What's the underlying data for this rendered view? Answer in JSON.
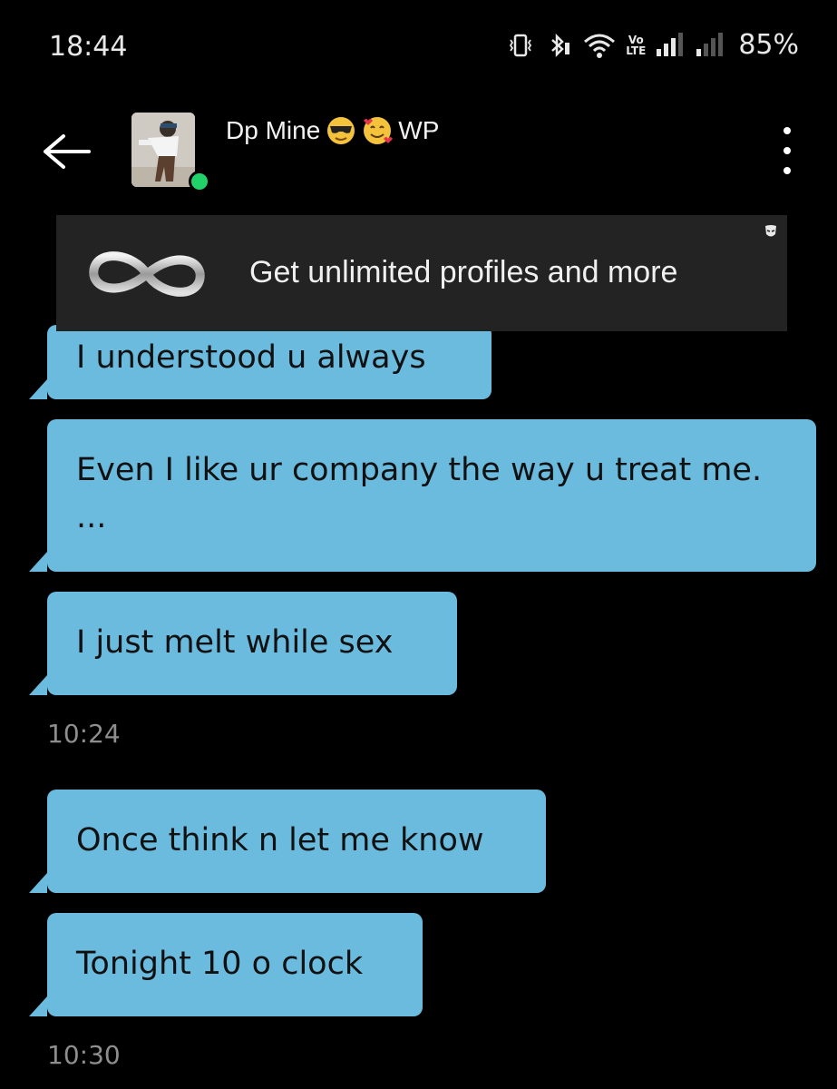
{
  "status_bar": {
    "time": "18:44",
    "volte_top": "Vo",
    "volte_bottom": "LTE",
    "battery": "85%",
    "icons": [
      "vibrate-icon",
      "bluetooth-icon",
      "wifi-icon",
      "volte-icon",
      "signal-icon",
      "signal-icon",
      "battery-text"
    ]
  },
  "header": {
    "contact_name": "Dp Mine",
    "contact_suffix": "WP",
    "name_emojis": [
      "sunglasses-emoji",
      "smiling-face-with-hearts-emoji"
    ],
    "online": true,
    "online_color": "#21d16a"
  },
  "promo": {
    "text": "Get unlimited profiles and more",
    "icon": "infinity-icon"
  },
  "messages": [
    {
      "text": "I understood u always"
    },
    {
      "text": "Even I like ur company the way u treat me. ..."
    },
    {
      "text": "I just melt while sex"
    },
    {
      "timestamp": "10:24"
    },
    {
      "text": "Once think n let me know"
    },
    {
      "text": "Tonight 10 o clock"
    },
    {
      "timestamp": "10:30"
    }
  ],
  "colors": {
    "background": "#000000",
    "bubble": "#6bbbdf",
    "bubble_text": "#111111",
    "timestamp": "#8e8e8e",
    "promo_bg": "#232323"
  }
}
